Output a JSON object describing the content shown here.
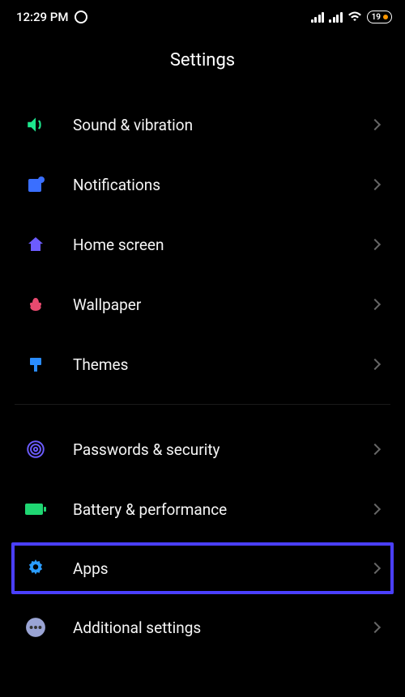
{
  "status_bar": {
    "time": "12:29 PM",
    "battery_percent": "19"
  },
  "page": {
    "title": "Settings"
  },
  "menu": {
    "group1": [
      {
        "label": "Sound & vibration"
      },
      {
        "label": "Notifications"
      },
      {
        "label": "Home screen"
      },
      {
        "label": "Wallpaper"
      },
      {
        "label": "Themes"
      }
    ],
    "group2": [
      {
        "label": "Passwords & security"
      },
      {
        "label": "Battery & performance"
      },
      {
        "label": "Apps"
      },
      {
        "label": "Additional settings"
      }
    ]
  }
}
